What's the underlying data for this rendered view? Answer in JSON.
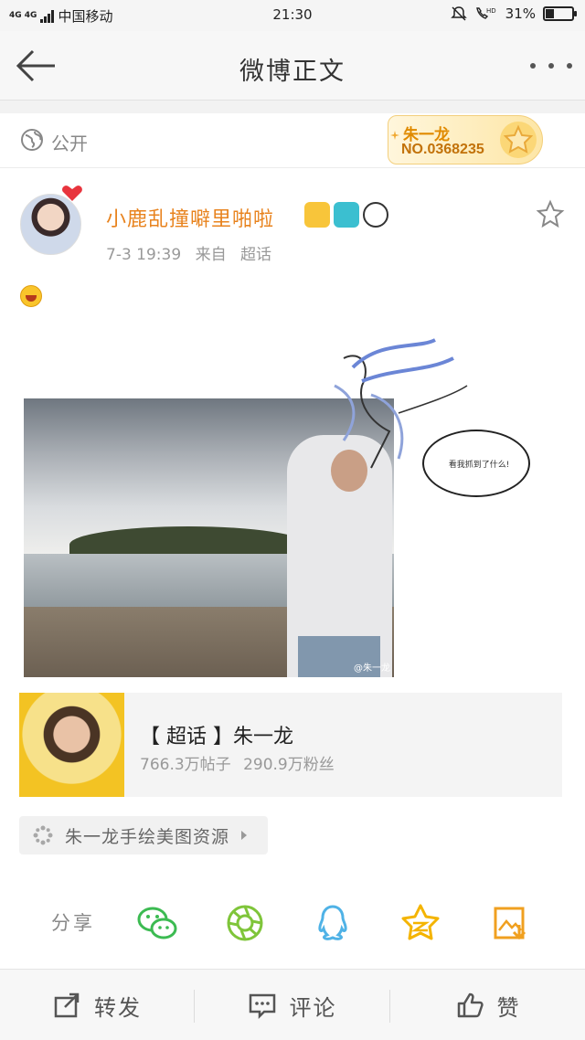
{
  "status_bar": {
    "network": "4G 4G",
    "carrier": "中国移动",
    "time": "21:30",
    "battery": "31%",
    "battery_level": 0.31
  },
  "nav": {
    "title": "微博正文",
    "back_icon": "back-arrow-icon",
    "more_icon": "more-dots-icon"
  },
  "visibility": {
    "label": "公开",
    "icon": "globe-icon"
  },
  "fan_badge": {
    "name": "朱一龙",
    "number": "NO.0368235",
    "accent": "#e08a00"
  },
  "post": {
    "author": "小鹿乱撞噼里啪啦",
    "author_color": "#e8831e",
    "author_badges": [
      "crown-icon",
      "camera-icon",
      "panda-icon"
    ],
    "date": "7-3 19:39",
    "source_prefix": "来自",
    "source": "超话",
    "emoji": "laughing-emoji",
    "image_bubble_text": "看我抓到了什么!",
    "image_watermark": "@朱一龙"
  },
  "supertopic": {
    "title": "【 超话 】朱一龙",
    "posts": "766.3万帖子",
    "fans": "290.9万粉丝"
  },
  "tag": {
    "label": "朱一龙手绘美图资源"
  },
  "share": {
    "label": "分享",
    "targets": [
      "wechat-icon",
      "moments-icon",
      "qq-icon",
      "qzone-icon",
      "save-image-icon"
    ]
  },
  "actions": {
    "repost": "转发",
    "comment": "评论",
    "like": "赞"
  }
}
